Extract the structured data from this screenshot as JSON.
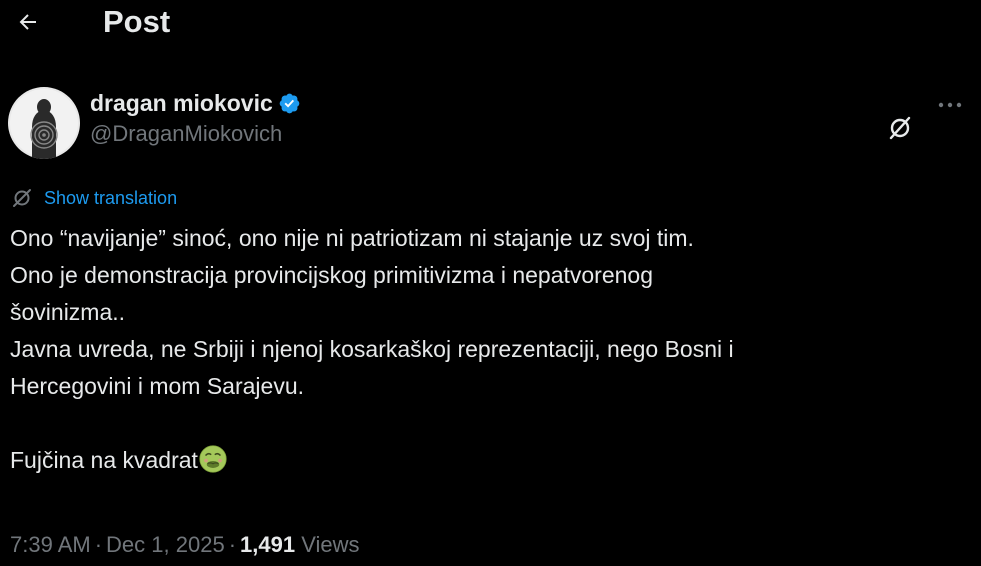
{
  "header": {
    "title": "Post"
  },
  "author": {
    "display_name": "dragan miokovic",
    "handle": "@DraganMiokovich",
    "verified": true
  },
  "translation": {
    "label": "Show translation"
  },
  "tweet": {
    "lines": [
      "Ono “navijanje” sinoć, ono nije ni patriotizam ni stajanje uz svoj tim.",
      "Ono je demonstracija provincijskog primitivizma i nepatvorenog",
      "šovinizma..",
      "Javna uvreda, ne Srbiji i njenoj kosarkaškoj reprezentaciji, nego Bosni i",
      "Hercegovini i mom Sarajevu.",
      "",
      "Fujčina na kvadrat"
    ],
    "emoji": "nauseated-face"
  },
  "meta": {
    "time": "7:39 AM",
    "separator": "·",
    "date": "Dec 1, 2025",
    "views_count": "1,491",
    "views_label": "Views"
  },
  "colors": {
    "background": "#000000",
    "text_primary": "#e7e9ea",
    "text_secondary": "#71767b",
    "accent": "#1d9bf0"
  },
  "icons": {
    "back": "arrow-left-icon",
    "verified": "verified-badge-icon",
    "grok": "grok-icon",
    "more": "more-horizontal-icon",
    "translate": "translate-icon"
  }
}
